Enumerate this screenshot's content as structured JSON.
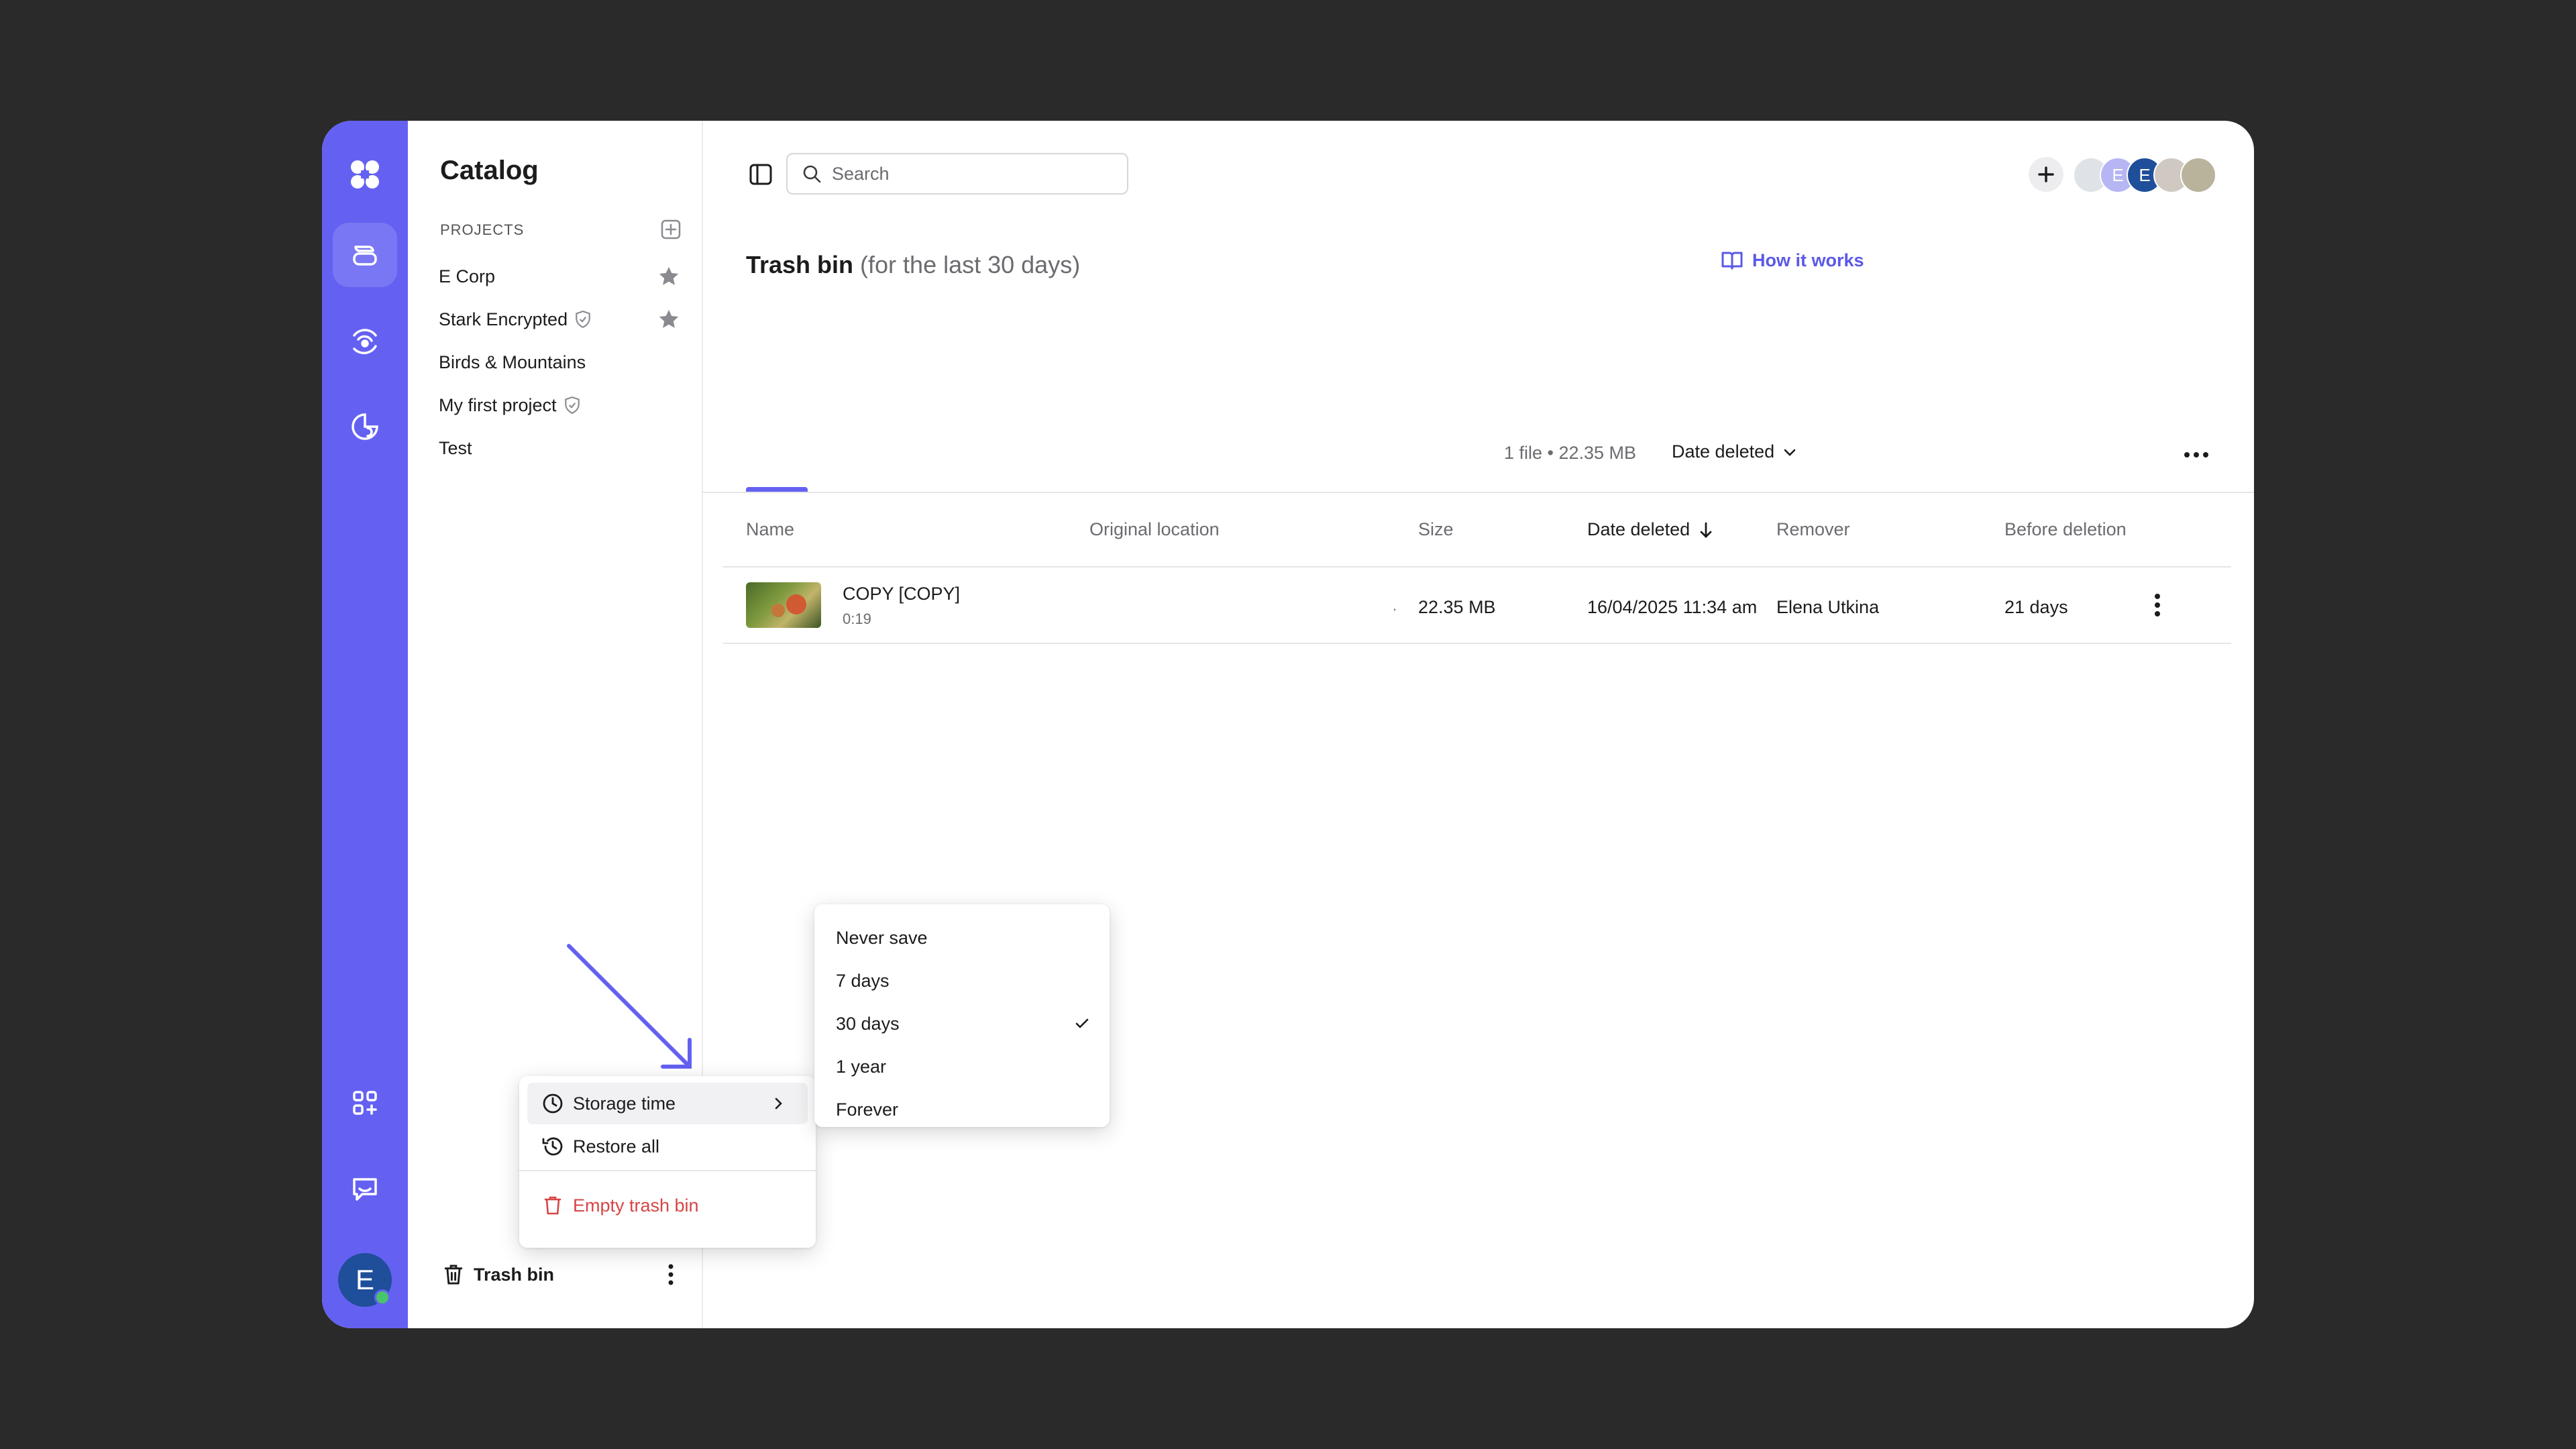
{
  "colors": {
    "accent": "#6461f2",
    "link": "#5b59e8",
    "danger": "#d64545"
  },
  "rail": {
    "user_initial": "E",
    "icons": [
      "logo-icon",
      "catalog-icon",
      "broadcast-icon",
      "analytics-icon",
      "apps-icon",
      "chat-icon"
    ]
  },
  "catalog": {
    "title": "Catalog",
    "projects_label": "PROJECTS",
    "projects": [
      {
        "name": "E Corp",
        "starred": true,
        "encrypted": false
      },
      {
        "name": "Stark Encrypted",
        "starred": true,
        "encrypted": true
      },
      {
        "name": "Birds & Mountains",
        "starred": false,
        "encrypted": false
      },
      {
        "name": "My first project",
        "starred": false,
        "encrypted": true
      },
      {
        "name": "Test",
        "starred": false,
        "encrypted": false
      }
    ],
    "trash_label": "Trash bin"
  },
  "header": {
    "search_placeholder": "Search",
    "member_initials": [
      "",
      "E",
      "E",
      "",
      ""
    ]
  },
  "page": {
    "title": "Trash bin",
    "subtitle": "(for the last 30 days)",
    "how_it_works": "How it works",
    "summary": "1 file • 22.35 MB",
    "sort_label": "Date deleted"
  },
  "table": {
    "columns": {
      "name": "Name",
      "location": "Original location",
      "size": "Size",
      "date": "Date deleted",
      "remover": "Remover",
      "before": "Before deletion"
    },
    "rows": [
      {
        "name": "COPY [COPY]",
        "duration": "0:19",
        "location": ".",
        "size": "22.35 MB",
        "date": "16/04/2025 11:34 am",
        "remover": "Elena Utkina",
        "before": "21 days"
      }
    ]
  },
  "context_menu": {
    "storage_time": "Storage time",
    "restore_all": "Restore all",
    "empty_trash": "Empty trash bin"
  },
  "storage_menu": {
    "options": [
      "Never save",
      "7 days",
      "30 days",
      "1 year",
      "Forever"
    ],
    "selected": "30 days"
  }
}
